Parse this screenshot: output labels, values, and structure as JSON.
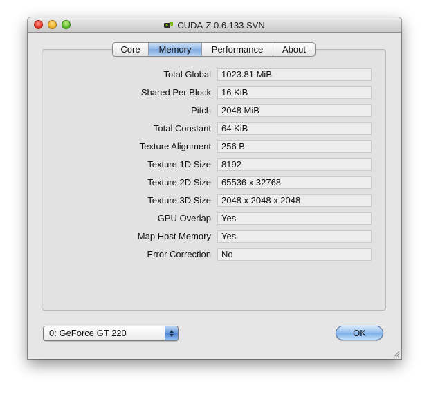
{
  "window": {
    "title": "CUDA-Z 0.6.133 SVN"
  },
  "tabs": [
    {
      "label": "Core",
      "active": false
    },
    {
      "label": "Memory",
      "active": true
    },
    {
      "label": "Performance",
      "active": false
    },
    {
      "label": "About",
      "active": false
    }
  ],
  "memory": {
    "rows": [
      {
        "label": "Total Global",
        "value": "1023.81 MiB"
      },
      {
        "label": "Shared Per Block",
        "value": "16 KiB"
      },
      {
        "label": "Pitch",
        "value": "2048 MiB"
      },
      {
        "label": "Total Constant",
        "value": "64 KiB"
      },
      {
        "label": "Texture Alignment",
        "value": "256 B"
      },
      {
        "label": "Texture 1D Size",
        "value": "8192"
      },
      {
        "label": "Texture 2D Size",
        "value": "65536 x 32768"
      },
      {
        "label": "Texture 3D Size",
        "value": "2048 x 2048 x 2048"
      },
      {
        "label": "GPU Overlap",
        "value": "Yes"
      },
      {
        "label": "Map Host Memory",
        "value": "Yes"
      },
      {
        "label": "Error Correction",
        "value": "No"
      }
    ]
  },
  "device": {
    "selected": "0: GeForce GT 220"
  },
  "buttons": {
    "ok_label": "OK"
  },
  "icons": {
    "close": "close-traffic-light-icon",
    "minimize": "minimize-traffic-light-icon",
    "zoom": "zoom-traffic-light-icon",
    "app": "cuda-z-app-icon",
    "select_arrows": "up-down-arrows-icon",
    "resize": "resize-grip-icon"
  },
  "colors": {
    "close": "#e0362a",
    "minimize": "#f0b22c",
    "zoom": "#5fbb2f",
    "accent": "#7ea8de"
  }
}
